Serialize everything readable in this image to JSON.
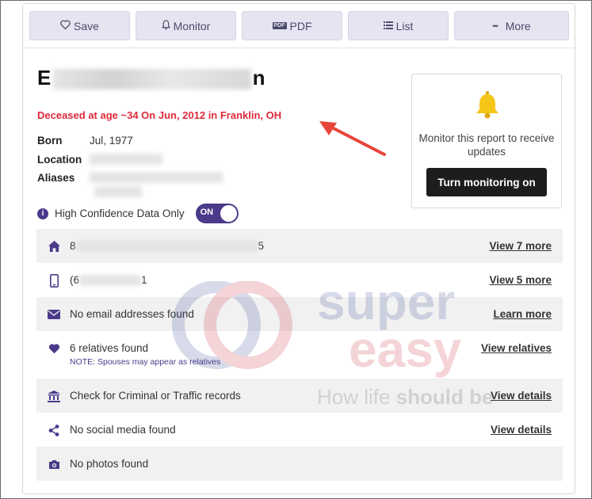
{
  "toolbar": {
    "save": "Save",
    "monitor": "Monitor",
    "pdf": "PDF",
    "pdf_badge": "PDF",
    "list": "List",
    "more": "More",
    "more_dots": "•••"
  },
  "person": {
    "name_start": "E",
    "name_end": "n",
    "deceased": "Deceased at age ~34 On Jun, 2012 in Franklin, OH",
    "facts": {
      "born_label": "Born",
      "born_value": "Jul, 1977",
      "location_label": "Location",
      "aliases_label": "Aliases"
    }
  },
  "monitor_box": {
    "text": "Monitor this report to receive updates",
    "button": "Turn monitoring on"
  },
  "confidence": {
    "label": "High Confidence Data Only",
    "info": "i",
    "toggle": "ON"
  },
  "rows": [
    {
      "icon": "home-icon",
      "text_start": "8",
      "text_end": "5",
      "link": "View 7 more"
    },
    {
      "icon": "phone-icon",
      "text_start": "(6",
      "text_end": "1",
      "link": "View 5 more"
    },
    {
      "icon": "email-icon",
      "text": "No email addresses found",
      "link": "Learn more"
    },
    {
      "icon": "heart-icon",
      "text": "6 relatives found",
      "note": "NOTE: Spouses may appear as relatives",
      "link": "View relatives"
    },
    {
      "icon": "bank-icon",
      "text": "Check for Criminal or Traffic records",
      "link": "View details"
    },
    {
      "icon": "share-icon",
      "text": "No social media found",
      "link": "View details"
    },
    {
      "icon": "camera-icon",
      "text": "No photos found"
    }
  ],
  "watermark": {
    "line1": "super",
    "line2": "easy",
    "tagline_start": "How life ",
    "tagline_bold": "should be"
  },
  "colors": {
    "accent": "#4b3a8a",
    "deceased": "#dd2a3a",
    "toolbar_bg": "#e6e4f1",
    "row_shade": "#f1f1f1",
    "bell": "#f5c518"
  }
}
